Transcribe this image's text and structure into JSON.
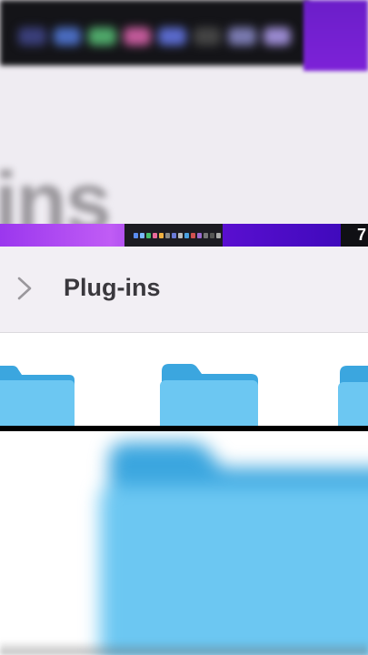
{
  "zoom_preview": {
    "blurred_label": "ins"
  },
  "strip": {
    "corner_glyph": "7"
  },
  "finder": {
    "path_title": "Plug-ins",
    "back_icon": "chevron-right-icon",
    "folders": [
      {
        "icon": "folder-icon"
      },
      {
        "icon": "folder-icon"
      },
      {
        "icon": "folder-icon"
      }
    ]
  },
  "colors": {
    "folder_body": "#6cc7f2",
    "folder_tab": "#3ba6df",
    "accent_purple": "#7d22d8",
    "path_text": "#3a383d"
  }
}
